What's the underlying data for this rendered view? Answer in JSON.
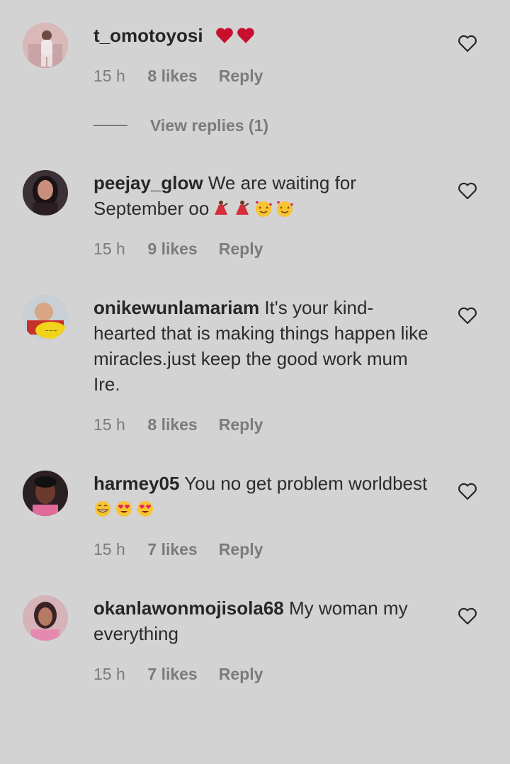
{
  "comments": [
    {
      "username": "t_omotoyosi",
      "text": "",
      "emojis": [
        "red-heart-icon",
        "red-heart-icon"
      ],
      "time": "15 h",
      "likes": "8 likes",
      "reply": "Reply",
      "view_replies": "View replies (1)"
    },
    {
      "username": "peejay_glow",
      "text": "We are waiting for September oo",
      "emojis": [
        "dancer-icon",
        "dancer-icon",
        "smiling-face-hearts-icon",
        "smiling-face-hearts-icon"
      ],
      "time": "15 h",
      "likes": "9 likes",
      "reply": "Reply"
    },
    {
      "username": "onikewunlamariam",
      "text": "It's your kind-hearted that is making things happen like miracles.just keep the good work mum Ire.",
      "emojis": [],
      "time": "15 h",
      "likes": "8 likes",
      "reply": "Reply"
    },
    {
      "username": "harmey05",
      "text": "You no get problem worldbest",
      "emojis": [
        "grinning-face-icon",
        "heart-eyes-icon",
        "heart-eyes-icon"
      ],
      "time": "15 h",
      "likes": "7 likes",
      "reply": "Reply"
    },
    {
      "username": "okanlawonmojisola68",
      "text": "My woman my everything",
      "emojis": [],
      "time": "15 h",
      "likes": "7 likes",
      "reply": "Reply"
    }
  ],
  "colors": {
    "background": "#d3d3d3",
    "meta_text": "#7b7b7b",
    "username": "#262626",
    "heart_emoji": "#c8102e"
  }
}
